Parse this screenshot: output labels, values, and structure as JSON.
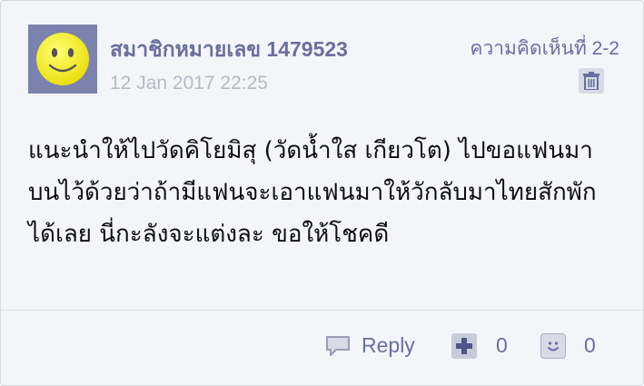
{
  "post": {
    "username": "สมาชิกหมายเลข 1479523",
    "timestamp": "12 Jan 2017 22:25",
    "comment_number": "ความคิดเห็นที่ 2-2",
    "body": "แนะนำให้ไปวัดคิโยมิสุ (วัดน้ำใส เกียวโต) ไปขอแฟนมา บนไว้ด้วยว่าถ้ามีแฟนจะเอาแฟนมาให้วักลับมาไทยสักพัก ได้เลย นี่กะลังจะแต่งละ ขอให้โชคดี"
  },
  "actions": {
    "reply_label": "Reply",
    "plus_count": "0",
    "emotion_count": "0"
  },
  "icons": {
    "avatar": "smiley-face-icon",
    "delete": "trash-icon",
    "reply": "speech-bubble-icon",
    "plus": "plus-icon",
    "emotion": "smile-icon"
  },
  "colors": {
    "card_background": "#f4f5f9",
    "accent_text": "#6a6f9e",
    "muted_text": "#b6b9c6",
    "avatar_background": "#7c82ae",
    "smiley_yellow": "#f7ef1f"
  }
}
